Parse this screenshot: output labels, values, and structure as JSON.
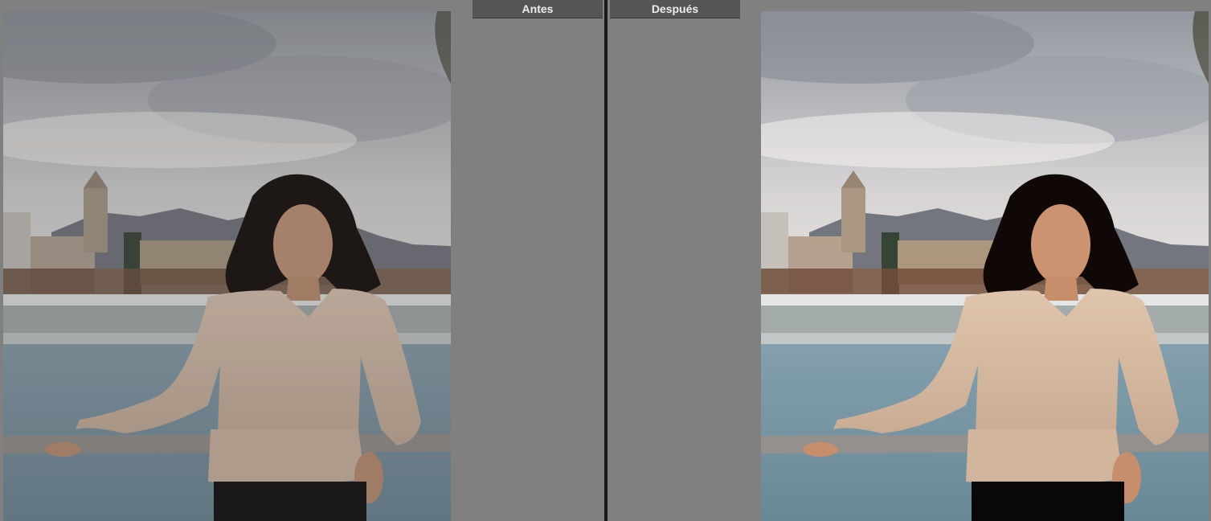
{
  "compare_view": {
    "before_label": "Antes",
    "after_label": "Después"
  },
  "photos": {
    "before": {
      "variant": "before",
      "brightness": 0.92,
      "contrast": 0.95
    },
    "after": {
      "variant": "after",
      "brightness": 1.04,
      "contrast": 1.08
    }
  },
  "colors": {
    "background": "#808080",
    "label_bg": "#555555",
    "label_text": "#eeeeee",
    "divider": "#1a1a1a"
  }
}
